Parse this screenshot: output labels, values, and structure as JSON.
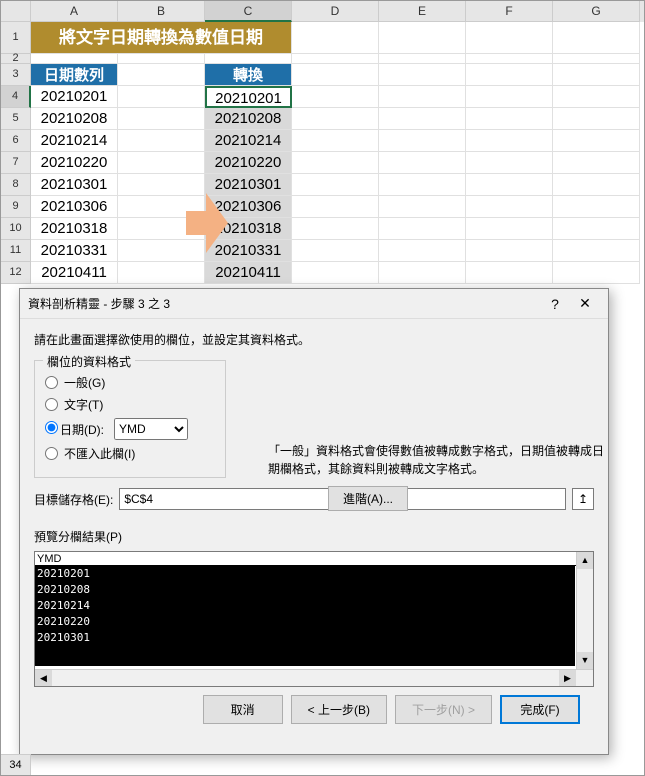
{
  "columns": [
    "A",
    "B",
    "C",
    "D",
    "E",
    "F",
    "G"
  ],
  "title_banner": "將文字日期轉換為數值日期",
  "headers": {
    "a": "日期數列",
    "c": "轉換"
  },
  "data_rows": [
    {
      "r": 4,
      "a": "20210201",
      "c": "20210201"
    },
    {
      "r": 5,
      "a": "20210208",
      "c": "20210208"
    },
    {
      "r": 6,
      "a": "20210214",
      "c": "20210214"
    },
    {
      "r": 7,
      "a": "20210220",
      "c": "20210220"
    },
    {
      "r": 8,
      "a": "20210301",
      "c": "20210301"
    },
    {
      "r": 9,
      "a": "20210306",
      "c": "20210306"
    },
    {
      "r": 10,
      "a": "20210318",
      "c": "20210318"
    },
    {
      "r": 11,
      "a": "20210331",
      "c": "20210331"
    },
    {
      "r": 12,
      "a": "20210411",
      "c": "20210411"
    }
  ],
  "row34": "34",
  "dialog": {
    "title": "資料剖析精靈 - 步驟 3 之 3",
    "help": "?",
    "close": "✕",
    "instruction": "請在此畫面選擇欲使用的欄位，並設定其資料格式。",
    "fieldset_legend": "欄位的資料格式",
    "opt_general": "一般(G)",
    "opt_text": "文字(T)",
    "opt_date": "日期(D):",
    "date_format": "YMD",
    "opt_skip": "不匯入此欄(I)",
    "info_text": "「一般」資料格式會使得數值被轉成數字格式，日期值被轉成日期欄格式，其餘資料則被轉成文字格式。",
    "advanced_btn": "進階(A)...",
    "target_label": "目標儲存格(E):",
    "target_value": "$C$4",
    "range_btn": "↥",
    "preview_label": "預覽分欄結果(P)",
    "preview_header": "YMD",
    "preview_rows": [
      "20210201",
      "20210208",
      "20210214",
      "20210220",
      "20210301"
    ],
    "btn_cancel": "取消",
    "btn_back": "< 上一步(B)",
    "btn_next": "下一步(N) >",
    "btn_finish": "完成(F)"
  }
}
